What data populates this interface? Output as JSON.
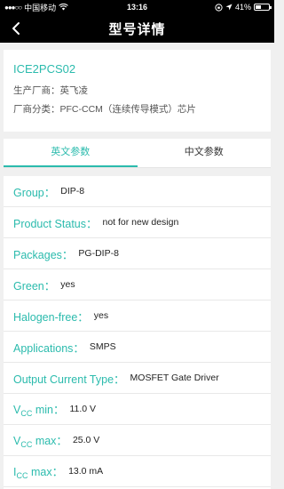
{
  "status": {
    "signal": "●●●○○",
    "carrier": "中国移动",
    "wifi": "wifi",
    "time": "13:16",
    "battery_percent": "41%",
    "battery_level": 0.41
  },
  "nav": {
    "title": "型号详情"
  },
  "info": {
    "part_number": "ICE2PCS02",
    "manufacturer_label": "生产厂商：",
    "manufacturer_value": "英飞凌",
    "category_label": "厂商分类：",
    "category_value": "PFC-CCM（连续传导模式）芯片"
  },
  "tabs": [
    {
      "label": "英文参数",
      "active": true
    },
    {
      "label": "中文参数",
      "active": false
    }
  ],
  "params": [
    {
      "label": "Group：",
      "value": "DIP-8"
    },
    {
      "label": "Product Status：",
      "value": "not for new design"
    },
    {
      "label": "Packages：",
      "value": "PG-DIP-8"
    },
    {
      "label": "Green：",
      "value": "yes"
    },
    {
      "label": "Halogen-free：",
      "value": "yes"
    },
    {
      "label": "Applications：",
      "value": "SMPS"
    },
    {
      "label": "Output Current Type：",
      "value": "MOSFET Gate Driver"
    },
    {
      "label_main": "V",
      "label_sub": "CC",
      "label_rest": " min：",
      "value": "11.0 V"
    },
    {
      "label_main": "V",
      "label_sub": "CC",
      "label_rest": " max：",
      "value": "25.0 V"
    },
    {
      "label_main": "I",
      "label_sub": "CC",
      "label_rest": " max：",
      "value": "13.0 mA"
    }
  ],
  "colors": {
    "accent": "#2bbbad",
    "bar": "#000000",
    "background": "#f0f0f0"
  }
}
